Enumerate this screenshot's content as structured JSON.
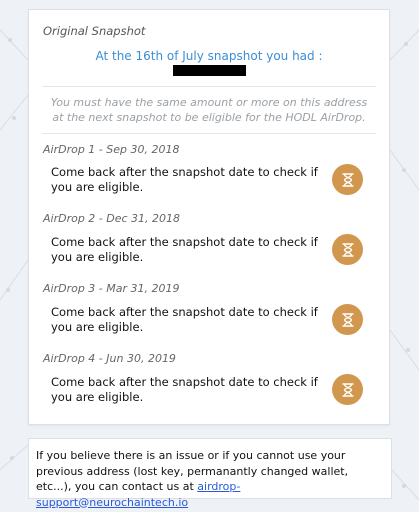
{
  "card": {
    "title": "Original Snapshot",
    "snapshot_text": "At the 16th of July snapshot you had :",
    "notice": "You must have the same amount or more on this address at the next snapshot to be eligible for the HODL AirDrop."
  },
  "airdrops": [
    {
      "header": "AirDrop 1 - Sep 30, 2018",
      "message": "Come back after the snapshot date to check if you are eligible.",
      "icon": "hourglass-icon"
    },
    {
      "header": "AirDrop 2 - Dec 31, 2018",
      "message": "Come back after the snapshot date to check if you are eligible.",
      "icon": "hourglass-icon"
    },
    {
      "header": "AirDrop 3 - Mar 31, 2019",
      "message": "Come back after the snapshot date to check if you are eligible.",
      "icon": "hourglass-icon"
    },
    {
      "header": "AirDrop 4 - Jun 30, 2019",
      "message": "Come back after the snapshot date to check if you are eligible.",
      "icon": "hourglass-icon"
    }
  ],
  "footer": {
    "text": "If you believe there is an issue or if you cannot use your previous address (lost key, permanantly changed wallet, etc...), you can contact us at ",
    "link": "airdrop-support@neurochaintech.io"
  },
  "colors": {
    "accent_blue": "#3b8ed4",
    "status_gold": "#d2974e",
    "link_blue": "#2a5bd7"
  }
}
